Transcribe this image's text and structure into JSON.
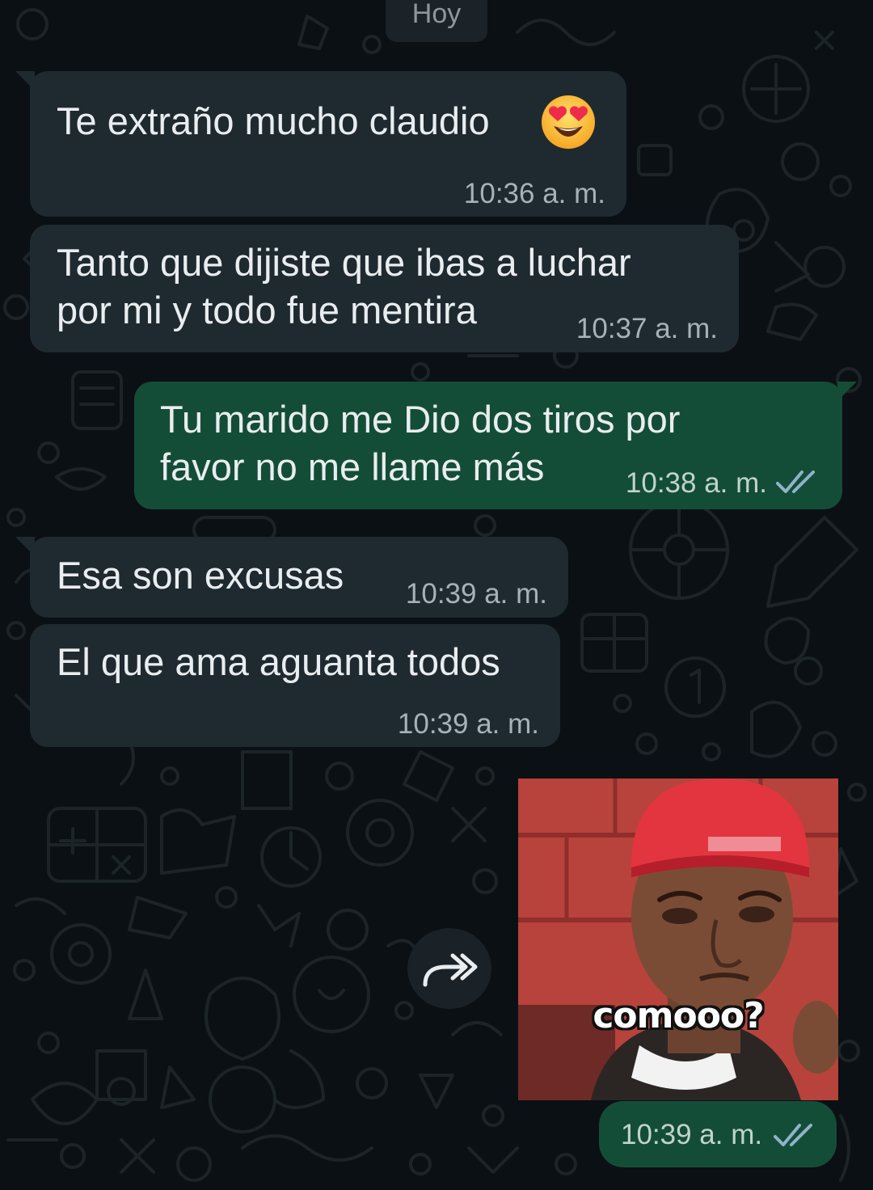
{
  "chat": {
    "date_chip": "Hoy",
    "messages": [
      {
        "direction": "incoming",
        "text": "Te extraño mucho claudio",
        "emoji": "smiling-face-with-heart-eyes",
        "time": "10:36 a. m."
      },
      {
        "direction": "incoming",
        "lines": [
          "Tanto que dijiste que ibas a luchar",
          "por mi y todo fue mentira"
        ],
        "time": "10:37 a. m."
      },
      {
        "direction": "outgoing",
        "lines": [
          "Tu marido me Dio dos tiros por",
          "favor no me llame más"
        ],
        "time": "10:38 a. m.",
        "status": "read"
      },
      {
        "direction": "incoming",
        "text": "Esa son excusas",
        "time": "10:39 a. m."
      },
      {
        "direction": "incoming",
        "text": "El que ama aguanta todos",
        "time": "10:39 a. m."
      },
      {
        "direction": "outgoing",
        "type": "sticker",
        "sticker_caption": "comooo?",
        "time": "10:39 a. m.",
        "status": "read"
      }
    ]
  },
  "icons": {
    "forward": "forward-icon",
    "read_receipt": "double-check-icon",
    "emoji": "heart-eyes-emoji-icon"
  },
  "colors": {
    "background": "#0b1014",
    "incoming_bubble": "#1f2a30",
    "outgoing_bubble": "#144d37",
    "read_tick": "#8fb3c9"
  }
}
